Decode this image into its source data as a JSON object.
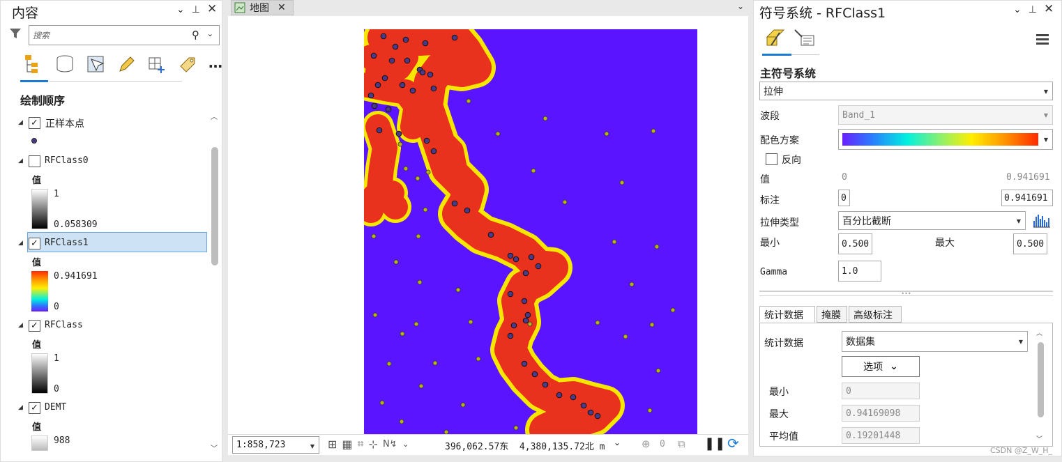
{
  "contents": {
    "title": "内容",
    "search_placeholder": "搜索",
    "section_title": "绘制顺序",
    "value_label": "值",
    "layers": [
      {
        "name": "正样本点",
        "checked": true
      },
      {
        "name": "RFClass0",
        "checked": false,
        "max": "1",
        "min": "0.058309"
      },
      {
        "name": "RFClass1",
        "checked": true,
        "max": "0.941691",
        "min": "0",
        "selected": true
      },
      {
        "name": "RFClass",
        "checked": true,
        "max": "1",
        "min": "0"
      },
      {
        "name": "DEMT",
        "checked": true,
        "max": "988"
      }
    ]
  },
  "map": {
    "tab_title": "地图",
    "scale": "1:858,723",
    "coords": "396,062.57东  4,380,135.72北 m",
    "selected_count": "0",
    "colors": {
      "background": "#5a14ff",
      "path": "#e8321e",
      "edge": "#f7e600"
    }
  },
  "symbology": {
    "title": "符号系统 - RFClass1",
    "primary_label": "主符号系统",
    "primary_value": "拉伸",
    "band_label": "波段",
    "band_value": "Band_1",
    "ramp_label": "配色方案",
    "invert_label": "反向",
    "value_label": "值",
    "value_min": "0",
    "value_max": "0.941691",
    "label_label": "标注",
    "label_min": "0",
    "label_max": "0.941691",
    "stretch_type_label": "拉伸类型",
    "stretch_type_value": "百分比截断",
    "min_label": "最小",
    "min_value": "0.500",
    "max_label": "最大",
    "max_value": "0.500",
    "gamma_label": "Gamma",
    "gamma_value": "1.0",
    "tabs": [
      "统计数据",
      "掩膜",
      "高级标注"
    ],
    "stats_label": "统计数据",
    "stats_value": "数据集",
    "options_label": "选项",
    "stat_min_label": "最小",
    "stat_min_value": "0",
    "stat_max_label": "最大",
    "stat_max_value": "0.94169098",
    "stat_mean_label": "平均值",
    "stat_mean_value": "0.19201448"
  },
  "watermark": "CSDN @Z_W_H_"
}
